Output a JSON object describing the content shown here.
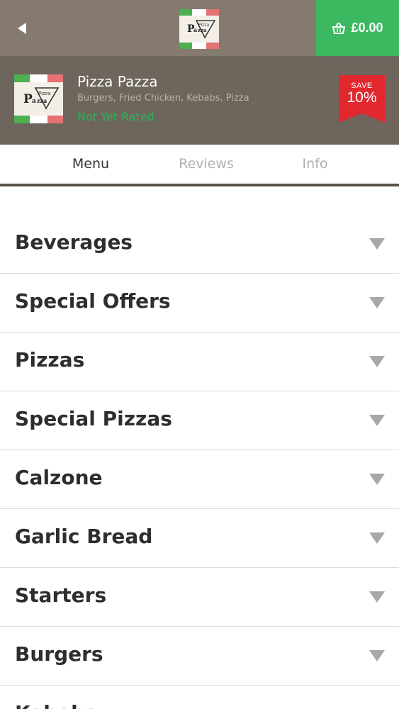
{
  "header": {
    "basket_total": "£0.00"
  },
  "restaurant": {
    "name": "Pizza Pazza",
    "cuisine": "Burgers, Fried Chicken, Kebabs, Pizza",
    "rating": "Not Yet Rated",
    "save_label": "SAVE",
    "save_percent": "10%",
    "logo_text_a": "Pizza",
    "logo_text_b": "Pa",
    "logo_text_c": "zza"
  },
  "tabs": [
    {
      "label": "Menu",
      "active": true
    },
    {
      "label": "Reviews",
      "active": false
    },
    {
      "label": "Info",
      "active": false
    }
  ],
  "categories": [
    {
      "label": "Beverages"
    },
    {
      "label": "Special Offers"
    },
    {
      "label": "Pizzas"
    },
    {
      "label": "Special Pizzas"
    },
    {
      "label": "Calzone"
    },
    {
      "label": "Garlic Bread"
    },
    {
      "label": "Starters"
    },
    {
      "label": "Burgers"
    },
    {
      "label": "Kebabs"
    }
  ],
  "colors": {
    "topbar": "#847a6e",
    "basket": "#3cb861",
    "header": "#6e665d",
    "rating": "#2fb05a",
    "badge": "#e0282e"
  },
  "icons": {
    "back": "back-arrow-icon",
    "basket": "basket-icon",
    "chevron": "chevron-down-icon"
  }
}
